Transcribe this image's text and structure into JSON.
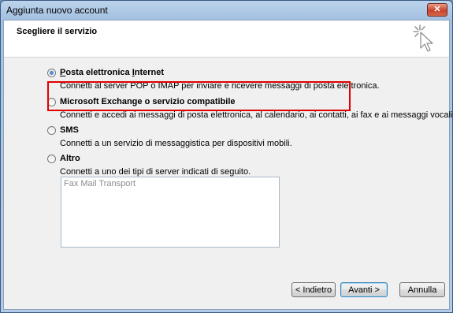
{
  "window": {
    "title": "Aggiunta nuovo account",
    "close_glyph": "✕"
  },
  "header": {
    "title": "Scegliere il servizio",
    "icon": "cursor-click-icon"
  },
  "options": [
    {
      "label": "Posta elettronica Internet",
      "description": "Connetti al server POP o IMAP per inviare e ricevere messaggi di posta elettronica.",
      "selected": true,
      "highlighted": true
    },
    {
      "label": "Microsoft Exchange o servizio compatibile",
      "description": "Connetti e accedi ai messaggi di posta elettronica, al calendario, ai contatti, ai fax e ai messaggi vocali.",
      "selected": false
    },
    {
      "label": "SMS",
      "description": "Connetti a un servizio di messaggistica per dispositivi mobili.",
      "selected": false
    },
    {
      "label": "Altro",
      "description": "Connetti a uno dei tipi di server indicati di seguito.",
      "selected": false
    }
  ],
  "server_list": {
    "items": [
      "Fax Mail Transport"
    ]
  },
  "buttons": {
    "back": "< Indietro",
    "next": "Avanti >",
    "cancel": "Annulla"
  },
  "colors": {
    "highlight": "#e00000",
    "title_bar": "#b3cbe6",
    "close_button": "#c8452c"
  }
}
